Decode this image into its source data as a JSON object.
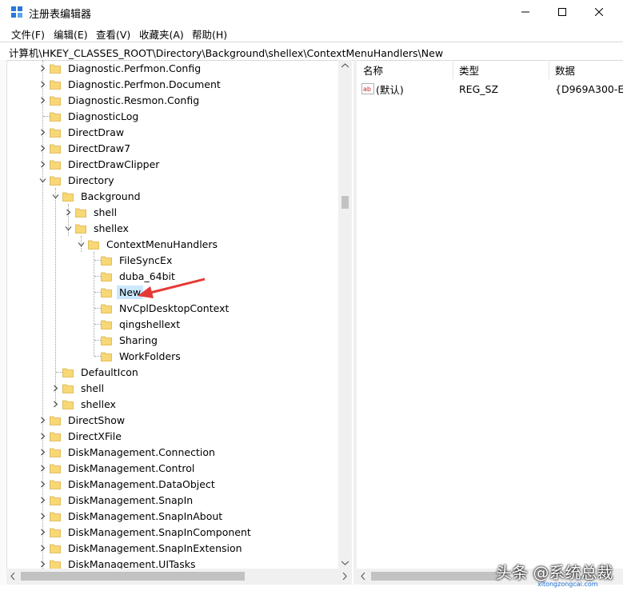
{
  "window": {
    "title": "注册表编辑器",
    "controls": {
      "minimize": "minimize-icon",
      "maximize": "maximize-icon",
      "close": "close-icon"
    }
  },
  "menu": [
    "文件(F)",
    "编辑(E)",
    "查看(V)",
    "收藏夹(A)",
    "帮助(H)"
  ],
  "address": "计算机\\HKEY_CLASSES_ROOT\\Directory\\Background\\shellex\\ContextMenuHandlers\\New",
  "tree": [
    {
      "label": "Diagnostic.Perfmon.Config",
      "level": 0,
      "expander": "collapsed"
    },
    {
      "label": "Diagnostic.Perfmon.Document",
      "level": 0,
      "expander": "collapsed"
    },
    {
      "label": "Diagnostic.Resmon.Config",
      "level": 0,
      "expander": "collapsed"
    },
    {
      "label": "DiagnosticLog",
      "level": 0,
      "expander": "none"
    },
    {
      "label": "DirectDraw",
      "level": 0,
      "expander": "collapsed"
    },
    {
      "label": "DirectDraw7",
      "level": 0,
      "expander": "collapsed"
    },
    {
      "label": "DirectDrawClipper",
      "level": 0,
      "expander": "collapsed"
    },
    {
      "label": "Directory",
      "level": 0,
      "expander": "expanded"
    },
    {
      "label": "Background",
      "level": 1,
      "expander": "expanded"
    },
    {
      "label": "shell",
      "level": 2,
      "expander": "collapsed"
    },
    {
      "label": "shellex",
      "level": 2,
      "expander": "expanded"
    },
    {
      "label": "ContextMenuHandlers",
      "level": 3,
      "expander": "expanded"
    },
    {
      "label": "FileSyncEx",
      "level": 4,
      "expander": "none"
    },
    {
      "label": "duba_64bit",
      "level": 4,
      "expander": "none"
    },
    {
      "label": "New",
      "level": 4,
      "expander": "none",
      "selected": true
    },
    {
      "label": "NvCplDesktopContext",
      "level": 4,
      "expander": "none"
    },
    {
      "label": "qingshellext",
      "level": 4,
      "expander": "none"
    },
    {
      "label": "Sharing",
      "level": 4,
      "expander": "none"
    },
    {
      "label": "WorkFolders",
      "level": 4,
      "expander": "none"
    },
    {
      "label": "DefaultIcon",
      "level": 1,
      "expander": "none"
    },
    {
      "label": "shell",
      "level": 1,
      "expander": "collapsed"
    },
    {
      "label": "shellex",
      "level": 1,
      "expander": "collapsed"
    },
    {
      "label": "DirectShow",
      "level": 0,
      "expander": "collapsed"
    },
    {
      "label": "DirectXFile",
      "level": 0,
      "expander": "collapsed"
    },
    {
      "label": "DiskManagement.Connection",
      "level": 0,
      "expander": "collapsed"
    },
    {
      "label": "DiskManagement.Control",
      "level": 0,
      "expander": "collapsed"
    },
    {
      "label": "DiskManagement.DataObject",
      "level": 0,
      "expander": "collapsed"
    },
    {
      "label": "DiskManagement.SnapIn",
      "level": 0,
      "expander": "collapsed"
    },
    {
      "label": "DiskManagement.SnapInAbout",
      "level": 0,
      "expander": "collapsed"
    },
    {
      "label": "DiskManagement.SnapInComponent",
      "level": 0,
      "expander": "collapsed"
    },
    {
      "label": "DiskManagement.SnapInExtension",
      "level": 0,
      "expander": "collapsed"
    },
    {
      "label": "DiskManagement.UITasks",
      "level": 0,
      "expander": "collapsed"
    }
  ],
  "columns": {
    "name": "名称",
    "type": "类型",
    "data": "数据"
  },
  "values": [
    {
      "icon": "string-value-icon",
      "name": "(默认)",
      "type": "REG_SZ",
      "data": "{D969A300-E"
    }
  ],
  "watermark": {
    "main": "头条 @系统总裁",
    "sub": "xitongzongcai.com"
  },
  "colors": {
    "selection": "#cce8ff",
    "folder": "#f8d775",
    "arrow": "#e53935"
  }
}
